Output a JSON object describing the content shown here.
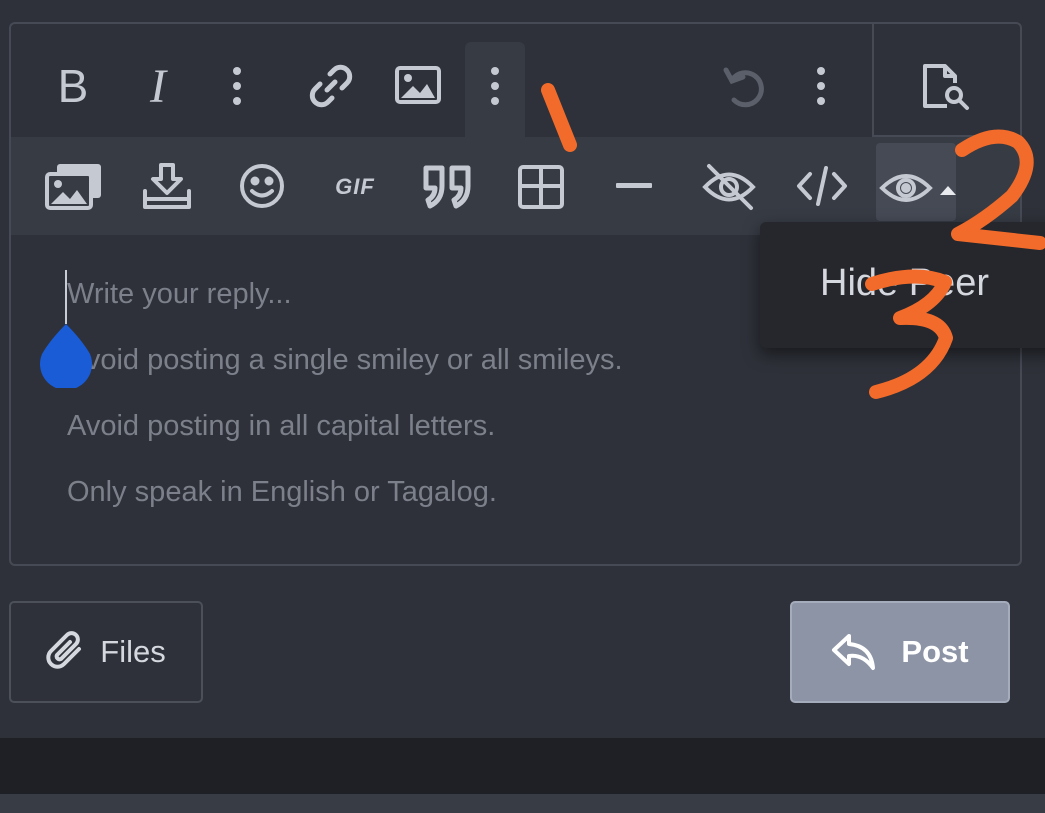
{
  "toolbar": {
    "row1": [
      {
        "name": "bold-icon",
        "glyph": "B"
      },
      {
        "name": "italic-icon",
        "glyph": "I"
      },
      {
        "name": "more-text-options-icon"
      },
      {
        "name": "link-icon"
      },
      {
        "name": "image-icon"
      },
      {
        "name": "more-insert-options-icon"
      },
      {
        "name": "undo-icon"
      },
      {
        "name": "more-options-icon"
      },
      {
        "name": "preview-icon"
      }
    ],
    "row2": [
      {
        "name": "media-gallery-icon"
      },
      {
        "name": "drafts-icon"
      },
      {
        "name": "smiley-icon"
      },
      {
        "name": "gif-icon",
        "glyph": "GIF"
      },
      {
        "name": "quote-icon"
      },
      {
        "name": "table-icon"
      },
      {
        "name": "horizontal-line-icon"
      },
      {
        "name": "spoiler-icon"
      },
      {
        "name": "code-icon"
      },
      {
        "name": "hide-icon"
      }
    ]
  },
  "tooltip": {
    "text": "Hide Peer"
  },
  "editor": {
    "placeholder_lines": [
      "Write your reply...",
      "Avoid posting a single smiley or all smileys.",
      "Avoid posting in all capital letters.",
      "Only speak in English or Tagalog."
    ]
  },
  "footer": {
    "files_label": "Files",
    "post_label": "Post"
  },
  "annotations": [
    "1",
    "2",
    "3"
  ],
  "colors": {
    "background": "#2e3139",
    "toolbar_secondary": "#373b44",
    "post_button": "#8c94a6",
    "annotation": "#f26b2a",
    "caret_handle": "#1a5bd6"
  }
}
